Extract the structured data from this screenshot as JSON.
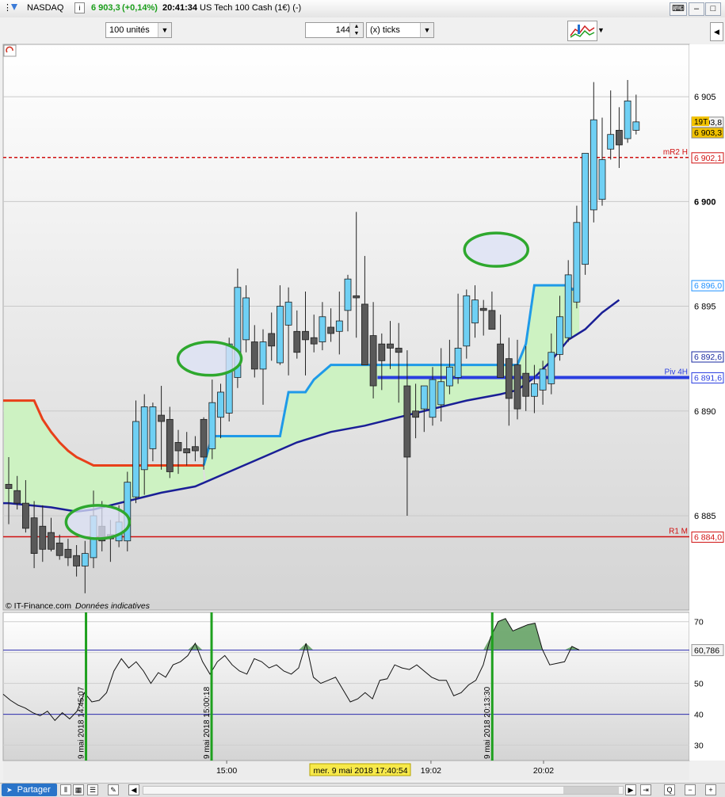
{
  "window": {
    "instrument": "NASDAQ",
    "last_price": "6 903,3",
    "change": "(+0,14%)",
    "time": "20:41:34",
    "description": "US Tech 100 Cash (1€) (-)",
    "colors": {
      "positive": "#1a9e1a"
    }
  },
  "toolbar": {
    "units_select": "100 unités",
    "ticks_value": "144",
    "ticks_select": "(x) ticks"
  },
  "bottom": {
    "partager_label": "Partager"
  },
  "chart_data": [
    {
      "type": "candlestick",
      "ylim": [
        6880.5,
        6907.5
      ],
      "x_count": 75,
      "y_ticks": [
        6885,
        6890,
        6895,
        6900,
        6905
      ],
      "y_tick_labels": [
        "6 885",
        "6 890",
        "6 895",
        "6 900",
        "6 905"
      ],
      "x_ticks": [
        {
          "i": 23,
          "label": "15:00"
        },
        {
          "i": 47,
          "label": "19:02"
        },
        {
          "i": 60,
          "label": "20:02"
        }
      ],
      "cursor_time": "mer. 9 mai 2018 17:40:54",
      "copyright": "© IT-Finance.com",
      "disclaimer": "Données indicatives",
      "candles": [
        {
          "o": 6886.3,
          "h": 6887.8,
          "l": 6884.6,
          "c": 6886.5,
          "up": false
        },
        {
          "o": 6886.2,
          "h": 6886.9,
          "l": 6885.3,
          "c": 6885.6,
          "up": false
        },
        {
          "o": 6885.6,
          "h": 6886.7,
          "l": 6884.2,
          "c": 6884.4,
          "up": false
        },
        {
          "o": 6884.9,
          "h": 6885.7,
          "l": 6882.5,
          "c": 6883.2,
          "up": false
        },
        {
          "o": 6884.5,
          "h": 6885.5,
          "l": 6882.8,
          "c": 6883.4,
          "up": false
        },
        {
          "o": 6884.2,
          "h": 6884.9,
          "l": 6883.3,
          "c": 6883.4,
          "up": false
        },
        {
          "o": 6883.7,
          "h": 6884.1,
          "l": 6882.9,
          "c": 6883.1,
          "up": false
        },
        {
          "o": 6883.4,
          "h": 6883.9,
          "l": 6882.6,
          "c": 6883.0,
          "up": false
        },
        {
          "o": 6883.1,
          "h": 6883.6,
          "l": 6882.1,
          "c": 6882.6,
          "up": false
        },
        {
          "o": 6882.6,
          "h": 6883.8,
          "l": 6881.3,
          "c": 6883.2,
          "up": true
        },
        {
          "o": 6883.0,
          "h": 6886.2,
          "l": 6882.5,
          "c": 6885.0,
          "up": true
        },
        {
          "o": 6884.5,
          "h": 6885.7,
          "l": 6883.3,
          "c": 6883.8,
          "up": false
        },
        {
          "o": 6883.9,
          "h": 6884.8,
          "l": 6882.8,
          "c": 6884.1,
          "up": false
        },
        {
          "o": 6883.8,
          "h": 6885.5,
          "l": 6883.5,
          "c": 6884.7,
          "up": true
        },
        {
          "o": 6883.8,
          "h": 6887.1,
          "l": 6883.3,
          "c": 6886.6,
          "up": true
        },
        {
          "o": 6885.9,
          "h": 6890.5,
          "l": 6885.6,
          "c": 6889.5,
          "up": true
        },
        {
          "o": 6887.2,
          "h": 6890.8,
          "l": 6886.0,
          "c": 6890.2,
          "up": true
        },
        {
          "o": 6890.2,
          "h": 6890.4,
          "l": 6887.6,
          "c": 6888.2,
          "up": true
        },
        {
          "o": 6889.8,
          "h": 6891.2,
          "l": 6887.2,
          "c": 6889.5,
          "up": false
        },
        {
          "o": 6889.6,
          "h": 6890.2,
          "l": 6886.8,
          "c": 6887.1,
          "up": false
        },
        {
          "o": 6888.5,
          "h": 6889.1,
          "l": 6887.0,
          "c": 6888.1,
          "up": false
        },
        {
          "o": 6888.2,
          "h": 6889.0,
          "l": 6887.4,
          "c": 6888.0,
          "up": false
        },
        {
          "o": 6888.1,
          "h": 6888.8,
          "l": 6887.6,
          "c": 6888.3,
          "up": false
        },
        {
          "o": 6887.8,
          "h": 6889.7,
          "l": 6887.2,
          "c": 6889.6,
          "up": false
        },
        {
          "o": 6888.2,
          "h": 6891.5,
          "l": 6887.7,
          "c": 6890.4,
          "up": true
        },
        {
          "o": 6889.7,
          "h": 6891.3,
          "l": 6888.7,
          "c": 6890.9,
          "up": true
        },
        {
          "o": 6889.9,
          "h": 6893.5,
          "l": 6889.5,
          "c": 6893.2,
          "up": true
        },
        {
          "o": 6891.6,
          "h": 6896.8,
          "l": 6891.1,
          "c": 6895.9,
          "up": true
        },
        {
          "o": 6895.4,
          "h": 6896.0,
          "l": 6892.8,
          "c": 6893.4,
          "up": true
        },
        {
          "o": 6893.3,
          "h": 6894.1,
          "l": 6891.6,
          "c": 6892.0,
          "up": false
        },
        {
          "o": 6892.0,
          "h": 6893.9,
          "l": 6890.3,
          "c": 6893.3,
          "up": true
        },
        {
          "o": 6893.1,
          "h": 6894.7,
          "l": 6892.4,
          "c": 6893.7,
          "up": false
        },
        {
          "o": 6892.3,
          "h": 6896.0,
          "l": 6892.2,
          "c": 6895.0,
          "up": true
        },
        {
          "o": 6894.1,
          "h": 6895.9,
          "l": 6891.7,
          "c": 6895.2,
          "up": true
        },
        {
          "o": 6893.8,
          "h": 6894.8,
          "l": 6892.5,
          "c": 6892.8,
          "up": false
        },
        {
          "o": 6893.8,
          "h": 6895.7,
          "l": 6891.7,
          "c": 6893.4,
          "up": false
        },
        {
          "o": 6893.5,
          "h": 6894.6,
          "l": 6892.8,
          "c": 6893.2,
          "up": false
        },
        {
          "o": 6893.3,
          "h": 6895.2,
          "l": 6892.9,
          "c": 6894.5,
          "up": true
        },
        {
          "o": 6894.0,
          "h": 6894.9,
          "l": 6893.3,
          "c": 6893.7,
          "up": false
        },
        {
          "o": 6893.8,
          "h": 6895.7,
          "l": 6892.7,
          "c": 6894.3,
          "up": true
        },
        {
          "o": 6894.8,
          "h": 6896.5,
          "l": 6893.8,
          "c": 6896.3,
          "up": true
        },
        {
          "o": 6895.5,
          "h": 6899.5,
          "l": 6893.5,
          "c": 6895.4,
          "up": false
        },
        {
          "o": 6895.1,
          "h": 6897.4,
          "l": 6893.8,
          "c": 6892.2,
          "up": false
        },
        {
          "o": 6893.6,
          "h": 6895.2,
          "l": 6890.6,
          "c": 6891.2,
          "up": false
        },
        {
          "o": 6892.4,
          "h": 6893.7,
          "l": 6891.0,
          "c": 6893.2,
          "up": false
        },
        {
          "o": 6893.0,
          "h": 6894.3,
          "l": 6892.0,
          "c": 6893.2,
          "up": false
        },
        {
          "o": 6893.0,
          "h": 6894.2,
          "l": 6890.4,
          "c": 6892.8,
          "up": false
        },
        {
          "o": 6891.2,
          "h": 6892.9,
          "l": 6885.0,
          "c": 6887.8,
          "up": false
        },
        {
          "o": 6889.7,
          "h": 6891.3,
          "l": 6888.7,
          "c": 6890.0,
          "up": false
        },
        {
          "o": 6890.1,
          "h": 6891.0,
          "l": 6889.0,
          "c": 6891.2,
          "up": true
        },
        {
          "o": 6889.7,
          "h": 6892.1,
          "l": 6889.3,
          "c": 6891.5,
          "up": true
        },
        {
          "o": 6890.3,
          "h": 6893.0,
          "l": 6889.5,
          "c": 6891.4,
          "up": true
        },
        {
          "o": 6891.2,
          "h": 6893.4,
          "l": 6890.8,
          "c": 6892.1,
          "up": true
        },
        {
          "o": 6891.6,
          "h": 6895.6,
          "l": 6891.3,
          "c": 6893.0,
          "up": true
        },
        {
          "o": 6893.1,
          "h": 6895.8,
          "l": 6892.5,
          "c": 6895.5,
          "up": true
        },
        {
          "o": 6894.2,
          "h": 6896.0,
          "l": 6893.5,
          "c": 6895.3,
          "up": true
        },
        {
          "o": 6894.8,
          "h": 6895.3,
          "l": 6893.6,
          "c": 6894.9,
          "up": false
        },
        {
          "o": 6894.8,
          "h": 6895.7,
          "l": 6893.9,
          "c": 6893.9,
          "up": false
        },
        {
          "o": 6893.2,
          "h": 6894.6,
          "l": 6892.3,
          "c": 6891.6,
          "up": false
        },
        {
          "o": 6892.5,
          "h": 6893.5,
          "l": 6889.3,
          "c": 6890.6,
          "up": false
        },
        {
          "o": 6892.2,
          "h": 6893.4,
          "l": 6889.6,
          "c": 6890.1,
          "up": false
        },
        {
          "o": 6891.8,
          "h": 6893.1,
          "l": 6890.0,
          "c": 6890.7,
          "up": false
        },
        {
          "o": 6890.7,
          "h": 6892.2,
          "l": 6889.9,
          "c": 6891.3,
          "up": true
        },
        {
          "o": 6891.0,
          "h": 6892.4,
          "l": 6890.3,
          "c": 6892.0,
          "up": true
        },
        {
          "o": 6891.3,
          "h": 6893.7,
          "l": 6890.8,
          "c": 6892.8,
          "up": true
        },
        {
          "o": 6892.7,
          "h": 6895.5,
          "l": 6892.4,
          "c": 6894.5,
          "up": true
        },
        {
          "o": 6893.5,
          "h": 6897.2,
          "l": 6893.3,
          "c": 6896.5,
          "up": true
        },
        {
          "o": 6895.2,
          "h": 6899.8,
          "l": 6894.9,
          "c": 6899.0,
          "up": true
        },
        {
          "o": 6897.0,
          "h": 6901.5,
          "l": 6896.5,
          "c": 6902.3,
          "up": true
        },
        {
          "o": 6899.6,
          "h": 6905.7,
          "l": 6899.0,
          "c": 6903.9,
          "up": true
        },
        {
          "o": 6900.1,
          "h": 6904.0,
          "l": 6899.8,
          "c": 6902.0,
          "up": true
        },
        {
          "o": 6903.2,
          "h": 6905.3,
          "l": 6902.0,
          "c": 6902.5,
          "up": true
        },
        {
          "o": 6902.7,
          "h": 6904.5,
          "l": 6901.6,
          "c": 6903.4,
          "up": false
        },
        {
          "o": 6903.0,
          "h": 6905.8,
          "l": 6902.8,
          "c": 6904.8,
          "up": true
        },
        {
          "o": 6903.8,
          "h": 6905.1,
          "l": 6903.2,
          "c": 6903.4,
          "up": true
        }
      ],
      "bands": {
        "red_line": {
          "start_i": 0,
          "end_i": 23,
          "values": [
            6890.5,
            6890.5,
            6890.5,
            6890.5,
            6889.6,
            6889.0,
            6888.5,
            6888.1,
            6887.8,
            6887.6,
            6887.4,
            6887.4,
            6887.4,
            6887.4,
            6887.4,
            6887.4,
            6887.4,
            6887.4,
            6887.4,
            6887.4,
            6887.4,
            6887.4,
            6887.4,
            6887.4
          ]
        },
        "light_blue_line": [
          {
            "i": 23,
            "v": 6887.4
          },
          {
            "i": 24,
            "v": 6888.8
          },
          {
            "i": 32,
            "v": 6888.8
          },
          {
            "i": 33,
            "v": 6890.9
          },
          {
            "i": 35,
            "v": 6890.9
          },
          {
            "i": 36,
            "v": 6891.5
          },
          {
            "i": 38,
            "v": 6892.2
          },
          {
            "i": 41,
            "v": 6892.2
          },
          {
            "i": 54,
            "v": 6892.2
          },
          {
            "i": 55,
            "v": 6892.2
          },
          {
            "i": 56,
            "v": 6892.2
          },
          {
            "i": 57,
            "v": 6892.2
          },
          {
            "i": 58,
            "v": 6892.2
          },
          {
            "i": 59,
            "v": 6892.2
          },
          {
            "i": 60,
            "v": 6892.2
          },
          {
            "i": 61,
            "v": 6893.2
          },
          {
            "i": 62,
            "v": 6896.0
          },
          {
            "i": 66,
            "v": 6896.0
          },
          {
            "i": 66.5,
            "v": 6895.8
          },
          {
            "i": 67.3,
            "v": 6896.0
          }
        ],
        "dark_blue_line": [
          {
            "i": 0,
            "v": 6885.6
          },
          {
            "i": 5,
            "v": 6885.4
          },
          {
            "i": 8,
            "v": 6885.2
          },
          {
            "i": 10,
            "v": 6885.3
          },
          {
            "i": 14,
            "v": 6885.7
          },
          {
            "i": 18,
            "v": 6886.1
          },
          {
            "i": 22,
            "v": 6886.4
          },
          {
            "i": 26,
            "v": 6887.1
          },
          {
            "i": 30,
            "v": 6887.8
          },
          {
            "i": 34,
            "v": 6888.5
          },
          {
            "i": 38,
            "v": 6889.0
          },
          {
            "i": 42,
            "v": 6889.3
          },
          {
            "i": 46,
            "v": 6889.7
          },
          {
            "i": 50,
            "v": 6890.1
          },
          {
            "i": 54,
            "v": 6890.5
          },
          {
            "i": 58,
            "v": 6890.8
          },
          {
            "i": 60,
            "v": 6891.0
          },
          {
            "i": 62,
            "v": 6891.6
          },
          {
            "i": 64,
            "v": 6892.4
          },
          {
            "i": 66,
            "v": 6893.4
          },
          {
            "i": 68,
            "v": 6893.9
          },
          {
            "i": 70,
            "v": 6894.7
          },
          {
            "i": 72,
            "v": 6895.3
          }
        ]
      },
      "levels": [
        {
          "name": "mR2 H",
          "value": 6902.1,
          "label": "6 902,1",
          "style": "dashed",
          "color": "#d01010"
        },
        {
          "name": "R1 M",
          "value": 6884.0,
          "label": "6 884,0",
          "style": "solid",
          "color": "#d01010"
        },
        {
          "name": "Piv 4H",
          "value": 6891.6,
          "label": "6 891,6",
          "style": "solid",
          "color": "#2a3ee0"
        }
      ],
      "price_tags": [
        {
          "value": 6903.8,
          "label": "6 903,8",
          "bg": "#f4f4f4",
          "fg": "#000000"
        },
        {
          "value": 6903.3,
          "label": "6 903,3",
          "bg": "#f2c200",
          "fg": "#000000",
          "badge": "19T"
        },
        {
          "value": 6896.0,
          "label": "6 896,0",
          "bg": "#ffffff",
          "fg": "#1e90ff"
        },
        {
          "value": 6892.6,
          "label": "6 892,6",
          "bg": "#ffffff",
          "fg": "#1a2aa0"
        }
      ],
      "highlight_ellipses": [
        {
          "i": 10.5,
          "v": 6884.7
        },
        {
          "i": 23.7,
          "v": 6892.5
        },
        {
          "i": 57.5,
          "v": 6897.7
        }
      ],
      "colors": {
        "up": "#6fd0f4",
        "down": "#595959",
        "band_fill": "#cdf2c2",
        "red": "#e8401a",
        "light_blue": "#1f9ae8",
        "dark_blue": "#1a1f96",
        "ellipse": "#2ea82e"
      }
    },
    {
      "type": "line",
      "name": "oscillator",
      "ylim": [
        25,
        73
      ],
      "y_ticks": [
        30,
        40,
        50,
        60,
        70
      ],
      "y_tick_labels": [
        "30",
        "40",
        "50",
        "60",
        "70"
      ],
      "reference_levels": [
        {
          "value": 60.786,
          "label": "60,786"
        },
        {
          "value": 40,
          "label": ""
        }
      ],
      "values": [
        46.5,
        44.5,
        43,
        42,
        40.5,
        39.5,
        41,
        38,
        40.5,
        38.5,
        41,
        47,
        44,
        44.5,
        47,
        54,
        58,
        55,
        57,
        54,
        50,
        53.5,
        52,
        56,
        57,
        59,
        63,
        57,
        53,
        57,
        59,
        56,
        54,
        53,
        58,
        57,
        55,
        56,
        54,
        53,
        55,
        63,
        52,
        50,
        51,
        52,
        48,
        44,
        45,
        47,
        45,
        51,
        51.5,
        56,
        55,
        54.5,
        56,
        54,
        52,
        51,
        51,
        46,
        47,
        49.5,
        51,
        56,
        65,
        70,
        71,
        67,
        68,
        69,
        69.5,
        61,
        56,
        56.5,
        57,
        62,
        60.8
      ],
      "vertical_markers": [
        {
          "i": 11,
          "label": "9 mai 2018 14:45:07"
        },
        {
          "i": 28,
          "label": "9 mai 2018 15:00:18"
        },
        {
          "i": 66,
          "label": "9 mai 2018 20:13:30"
        }
      ],
      "colors": {
        "line": "#111111",
        "area": "#5d9e5d",
        "reference": "#2d2db0",
        "markers": "#1ea01e"
      }
    }
  ]
}
